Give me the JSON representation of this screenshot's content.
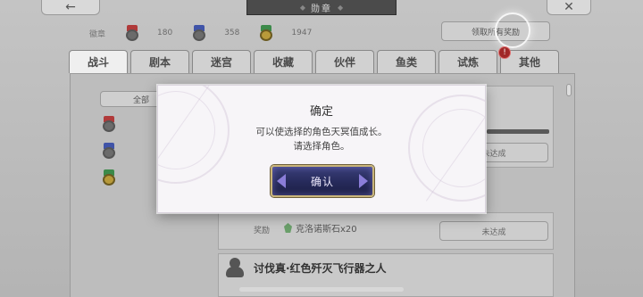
{
  "window": {
    "title": "勋章"
  },
  "header": {
    "back_icon": "←",
    "close_icon": "✕",
    "claim_all_label": "领取所有奖励",
    "notice_badge": "!"
  },
  "tiers": {
    "label": "徽章",
    "items": [
      {
        "color": "red",
        "count": "180"
      },
      {
        "color": "blue",
        "count": "358"
      },
      {
        "color": "green",
        "count": "1947"
      }
    ]
  },
  "tabs": [
    {
      "label": "战斗",
      "active": true
    },
    {
      "label": "剧本"
    },
    {
      "label": "迷宫"
    },
    {
      "label": "收藏"
    },
    {
      "label": "伙伴"
    },
    {
      "label": "鱼类"
    },
    {
      "label": "试炼"
    },
    {
      "label": "其他"
    }
  ],
  "filter": {
    "label": "全部"
  },
  "list": {
    "status_1": "未达成",
    "reward_label": "奖励",
    "reward_item": "克洛诺斯石x20",
    "status_2": "未达成",
    "boss_title": "讨伐真·红色歼灭飞行器之人"
  },
  "dialog": {
    "title": "确定",
    "line1": "可以使选择的角色天冥值成长。",
    "line2": "请选择角色。",
    "confirm_label": "确认"
  },
  "colors": {
    "dialog_bg": "#f7f5f8",
    "button_bg": "#262a5a",
    "button_border": "#c9b57a"
  }
}
